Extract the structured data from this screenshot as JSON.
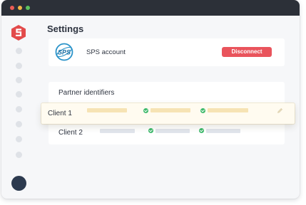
{
  "app": {
    "page_title": "Settings",
    "icons": [
      "app-logo-icon",
      "sps-logo-icon",
      "pencil-icon",
      "check-icon"
    ],
    "colors": {
      "brand": "#e34b4b",
      "danger_button": "#e9545c",
      "success": "#3cb96a",
      "titlebar": "#2c3038",
      "highlight_row": "#fffbf0"
    }
  },
  "account": {
    "name": "SPS account",
    "disconnect_label": "Disconnect"
  },
  "partners": {
    "title": "Partner identifiers",
    "rows": [
      {
        "label": "Client 1",
        "highlighted": true
      },
      {
        "label": "Client 2",
        "highlighted": false
      }
    ]
  }
}
